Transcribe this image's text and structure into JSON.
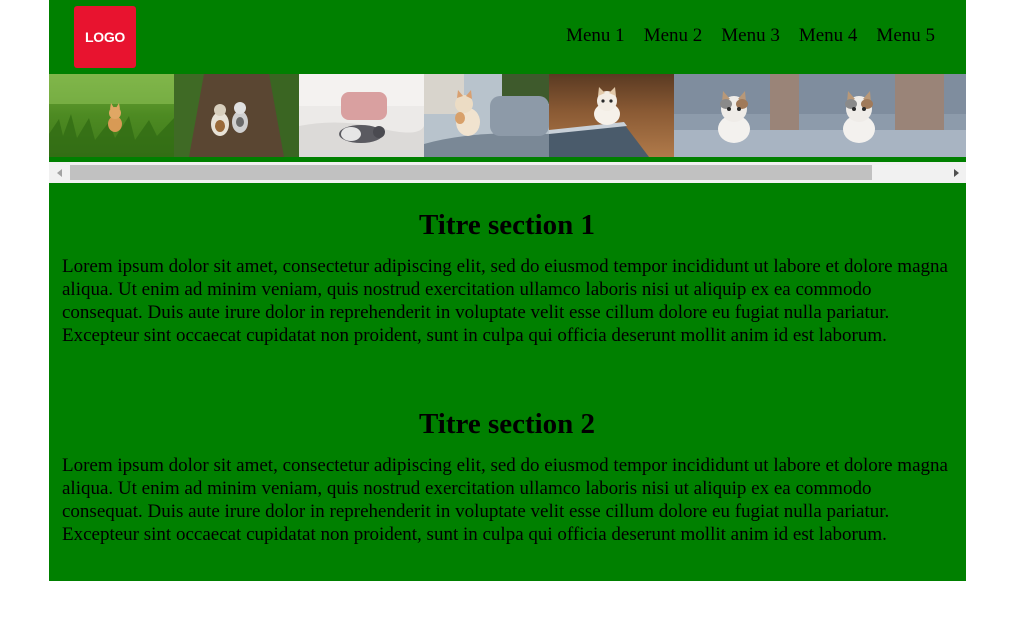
{
  "header": {
    "logo_text": "LOGO",
    "menu": [
      {
        "label": "Menu 1"
      },
      {
        "label": "Menu 2"
      },
      {
        "label": "Menu 3"
      },
      {
        "label": "Menu 4"
      },
      {
        "label": "Menu 5"
      }
    ]
  },
  "gallery": {
    "images": [
      {
        "icon": "kitten-in-grass-photo"
      },
      {
        "icon": "two-kittens-on-path-photo"
      },
      {
        "icon": "cat-sleeping-on-bed-photo"
      },
      {
        "icon": "kitten-on-sofa-photo"
      },
      {
        "icon": "kitten-on-table-photo"
      },
      {
        "icon": "kitten-on-grey-sofa-photo"
      },
      {
        "icon": "kitten-on-grey-sofa-photo"
      },
      {
        "icon": "kitten-on-grey-sofa-photo"
      }
    ],
    "scroll_position": 0
  },
  "sections": [
    {
      "title": "Titre section 1",
      "text": "Lorem ipsum dolor sit amet, consectetur adipiscing elit, sed do eiusmod tempor incididunt ut labore et dolore magna aliqua. Ut enim ad minim veniam, quis nostrud exercitation ullamco laboris nisi ut aliquip ex ea commodo consequat. Duis aute irure dolor in reprehenderit in voluptate velit esse cillum dolore eu fugiat nulla pariatur. Excepteur sint occaecat cupidatat non proident, sunt in culpa qui officia deserunt mollit anim id est laborum."
    },
    {
      "title": "Titre section 2",
      "text": "Lorem ipsum dolor sit amet, consectetur adipiscing elit, sed do eiusmod tempor incididunt ut labore et dolore magna aliqua. Ut enim ad minim veniam, quis nostrud exercitation ullamco laboris nisi ut aliquip ex ea commodo consequat. Duis aute irure dolor in reprehenderit in voluptate velit esse cillum dolore eu fugiat nulla pariatur. Excepteur sint occaecat cupidatat non proident, sunt in culpa qui officia deserunt mollit anim id est laborum."
    }
  ],
  "colors": {
    "page_background": "#008000",
    "logo_background": "#e8132f",
    "scrollbar_thumb": "#c1c1c1"
  }
}
